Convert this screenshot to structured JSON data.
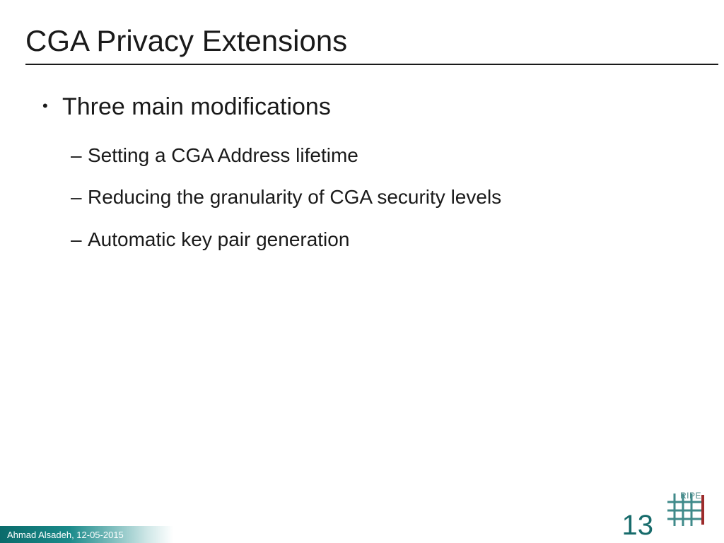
{
  "title": "CGA Privacy Extensions",
  "bullets": {
    "main": "Three main modifications",
    "subs": [
      "Setting a CGA Address lifetime",
      "Reducing the granularity of CGA security levels",
      "Automatic key pair generation"
    ]
  },
  "footer": {
    "author_date": "Ahmad Alsadeh, 12-05-2015",
    "page": "13",
    "logo_label": "RIPE"
  },
  "colors": {
    "accent": "#176b6b"
  }
}
